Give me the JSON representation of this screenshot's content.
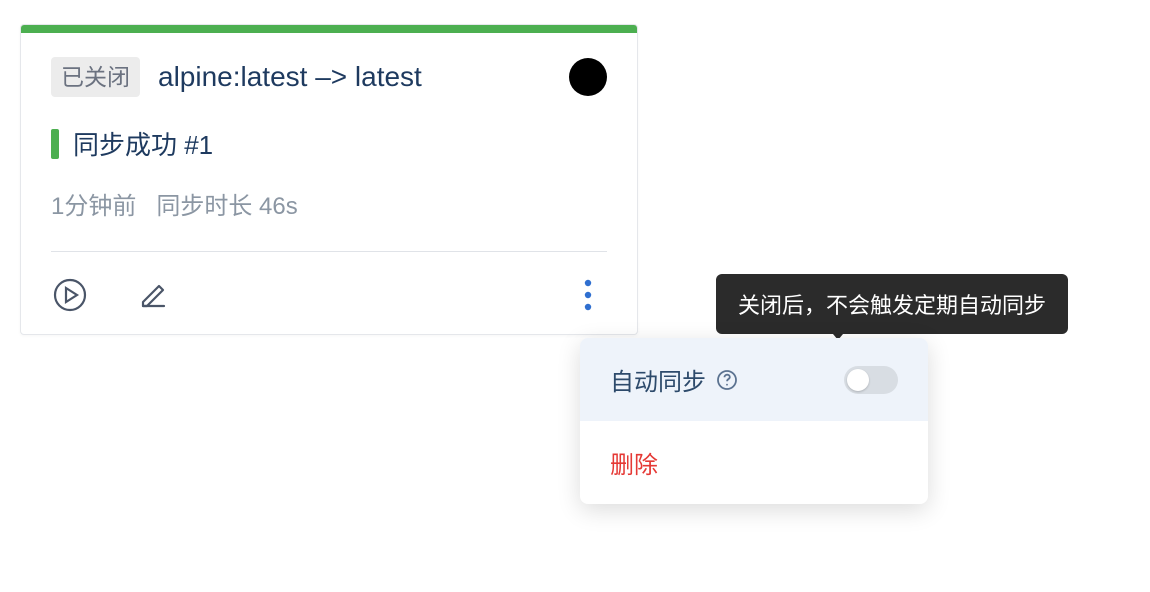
{
  "card": {
    "closed_badge": "已关闭",
    "title": "alpine:latest –> latest",
    "status_text": "同步成功 #1",
    "meta_time": "1分钟前",
    "meta_duration": "同步时长 46s"
  },
  "menu": {
    "auto_sync_label": "自动同步",
    "delete_label": "删除",
    "auto_sync_on": false
  },
  "tooltip": {
    "text": "关闭后，不会触发定期自动同步"
  },
  "icons": {
    "play": "play-icon",
    "edit": "pencil-icon",
    "more": "more-vertical-icon",
    "help": "question-circle-icon"
  }
}
